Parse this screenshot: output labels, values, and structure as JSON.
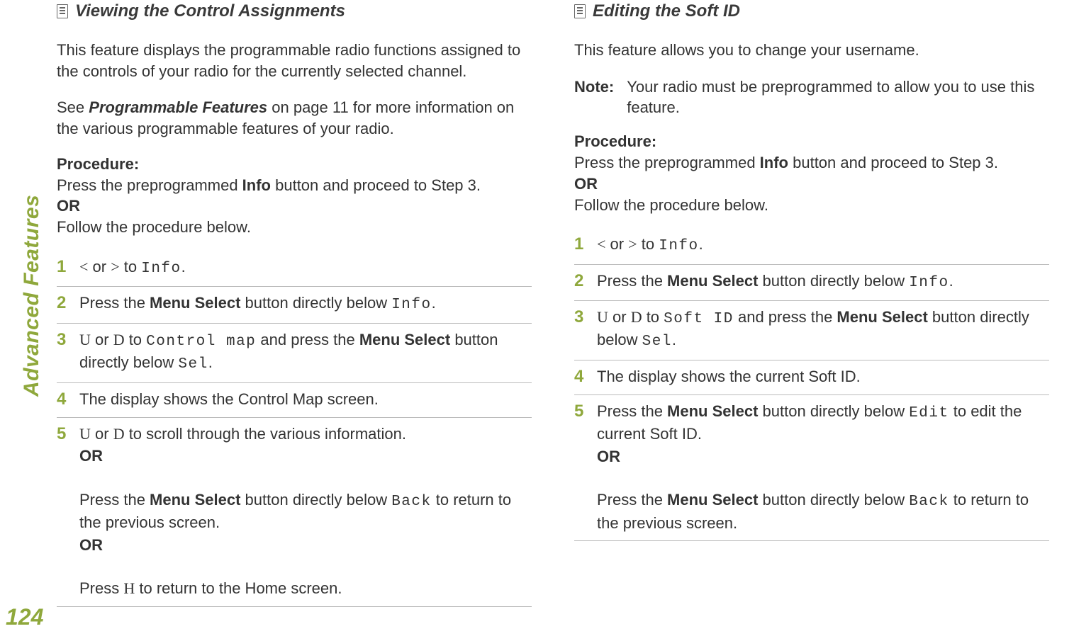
{
  "sidebar": {
    "label": "Advanced Features"
  },
  "page_number": "124",
  "left": {
    "heading": "Viewing the Control Assignments",
    "intro1": "This feature displays the programmable radio functions assigned to the controls of your radio for the currently selected channel.",
    "intro2_pre": "See ",
    "intro2_bold": "Programmable Features",
    "intro2_post": " on page 11 for more information on the various programmable features of your radio.",
    "proc_label": "Procedure:",
    "proc_line_pre": "Press the preprogrammed ",
    "proc_line_bold": "Info",
    "proc_line_post": " button and proceed to Step 3.",
    "or": "OR",
    "proc_follow": "Follow the procedure below.",
    "steps": [
      {
        "n": "1",
        "parts": [
          {
            "t": "sym",
            "v": "<"
          },
          {
            "t": "txt",
            "v": " or "
          },
          {
            "t": "sym",
            "v": ">"
          },
          {
            "t": "txt",
            "v": " to "
          },
          {
            "t": "mono",
            "v": "Info"
          },
          {
            "t": "txt",
            "v": "."
          }
        ]
      },
      {
        "n": "2",
        "parts": [
          {
            "t": "txt",
            "v": "Press the "
          },
          {
            "t": "b",
            "v": "Menu Select"
          },
          {
            "t": "txt",
            "v": " button directly below "
          },
          {
            "t": "mono",
            "v": "Info"
          },
          {
            "t": "txt",
            "v": "."
          }
        ]
      },
      {
        "n": "3",
        "parts": [
          {
            "t": "sym",
            "v": "U"
          },
          {
            "t": "txt",
            "v": " or "
          },
          {
            "t": "sym",
            "v": "D"
          },
          {
            "t": "txt",
            "v": " to "
          },
          {
            "t": "mono",
            "v": "Control map"
          },
          {
            "t": "txt",
            "v": " and press the "
          },
          {
            "t": "b",
            "v": "Menu Select"
          },
          {
            "t": "txt",
            "v": " button directly below "
          },
          {
            "t": "mono",
            "v": "Sel"
          },
          {
            "t": "txt",
            "v": "."
          }
        ]
      },
      {
        "n": "4",
        "parts": [
          {
            "t": "txt",
            "v": "The display shows the Control Map screen."
          }
        ]
      },
      {
        "n": "5",
        "parts": [
          {
            "t": "sym",
            "v": "U"
          },
          {
            "t": "txt",
            "v": " or "
          },
          {
            "t": "sym",
            "v": "D"
          },
          {
            "t": "txt",
            "v": " to scroll through the various information."
          },
          {
            "t": "br"
          },
          {
            "t": "or",
            "v": "OR"
          },
          {
            "t": "br"
          },
          {
            "t": "txt",
            "v": "Press the "
          },
          {
            "t": "b",
            "v": "Menu Select"
          },
          {
            "t": "txt",
            "v": " button directly below "
          },
          {
            "t": "mono",
            "v": "Back"
          },
          {
            "t": "txt",
            "v": " to return to the previous screen."
          },
          {
            "t": "br"
          },
          {
            "t": "or",
            "v": "OR"
          },
          {
            "t": "br"
          },
          {
            "t": "txt",
            "v": "Press "
          },
          {
            "t": "sym",
            "v": "H"
          },
          {
            "t": "txt",
            "v": " to return to the Home screen."
          }
        ]
      }
    ]
  },
  "right": {
    "heading": "Editing the Soft ID",
    "intro1": "This feature allows you to change your username.",
    "note_label": "Note:",
    "note_text": "Your radio must be preprogrammed to allow you to use this feature.",
    "proc_label": "Procedure:",
    "proc_line_pre": "Press the preprogrammed ",
    "proc_line_bold": "Info",
    "proc_line_post": " button and proceed to Step 3.",
    "or": "OR",
    "proc_follow": "Follow the procedure below.",
    "steps": [
      {
        "n": "1",
        "parts": [
          {
            "t": "sym",
            "v": "<"
          },
          {
            "t": "txt",
            "v": " or "
          },
          {
            "t": "sym",
            "v": ">"
          },
          {
            "t": "txt",
            "v": " to "
          },
          {
            "t": "mono",
            "v": "Info"
          },
          {
            "t": "txt",
            "v": "."
          }
        ]
      },
      {
        "n": "2",
        "parts": [
          {
            "t": "txt",
            "v": "Press the "
          },
          {
            "t": "b",
            "v": "Menu Select"
          },
          {
            "t": "txt",
            "v": " button directly below "
          },
          {
            "t": "mono",
            "v": "Info"
          },
          {
            "t": "txt",
            "v": "."
          }
        ]
      },
      {
        "n": "3",
        "parts": [
          {
            "t": "sym",
            "v": "U"
          },
          {
            "t": "txt",
            "v": " or "
          },
          {
            "t": "sym",
            "v": "D"
          },
          {
            "t": "txt",
            "v": " to "
          },
          {
            "t": "mono",
            "v": "Soft ID"
          },
          {
            "t": "txt",
            "v": " and press the "
          },
          {
            "t": "b",
            "v": "Menu Select"
          },
          {
            "t": "txt",
            "v": " button directly below "
          },
          {
            "t": "mono",
            "v": "Sel"
          },
          {
            "t": "txt",
            "v": "."
          }
        ]
      },
      {
        "n": "4",
        "parts": [
          {
            "t": "txt",
            "v": "The display shows the current Soft ID."
          }
        ]
      },
      {
        "n": "5",
        "parts": [
          {
            "t": "txt",
            "v": "Press the "
          },
          {
            "t": "b",
            "v": "Menu Select"
          },
          {
            "t": "txt",
            "v": " button directly below "
          },
          {
            "t": "mono",
            "v": "Edit"
          },
          {
            "t": "txt",
            "v": " to edit the current Soft ID."
          },
          {
            "t": "br"
          },
          {
            "t": "or",
            "v": "OR"
          },
          {
            "t": "br"
          },
          {
            "t": "txt",
            "v": "Press the "
          },
          {
            "t": "b",
            "v": "Menu Select"
          },
          {
            "t": "txt",
            "v": " button directly below "
          },
          {
            "t": "mono",
            "v": "Back"
          },
          {
            "t": "txt",
            "v": " to return to the previous screen."
          }
        ]
      }
    ]
  }
}
